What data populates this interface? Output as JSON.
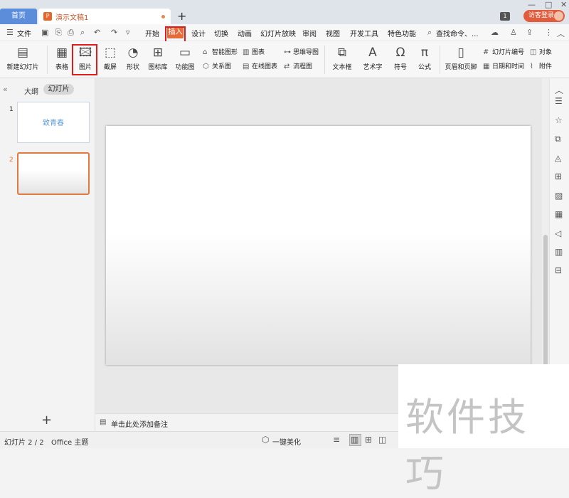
{
  "titlebar": {
    "home_tab": "首页",
    "doc_tab": "演示文稿1",
    "doc_icon": "P",
    "new_tab": "+",
    "window_badge": "1",
    "login": "访客登录",
    "controls": [
      "—",
      "□",
      "✕"
    ]
  },
  "menubar": {
    "file": "文件",
    "tabs": [
      "开始",
      "插入",
      "设计",
      "切换",
      "动画",
      "幻灯片放映",
      "审阅",
      "视图",
      "开发工具",
      "特色功能"
    ],
    "search": "查找命令、...",
    "active_tab": "插入"
  },
  "ribbon": {
    "new_slide": "新建幻灯片",
    "table": "表格",
    "picture": "图片",
    "screenshot": "截屏",
    "shape": "形状",
    "icon_library": "图标库",
    "function_chart": "功能图",
    "smart_art": "智能图形",
    "chart": "图表",
    "mind_map": "思维导图",
    "relation_chart": "关系图",
    "online_chart": "在线图表",
    "flow_chart": "流程图",
    "textbox": "文本框",
    "word_art": "艺术字",
    "symbol": "符号",
    "formula": "公式",
    "header_footer": "页眉和页脚",
    "slide_number": "幻灯片编号",
    "object": "对象",
    "date_time": "日期和时间",
    "attachment": "附件"
  },
  "leftpanel": {
    "outline": "大纲",
    "slides": "幻灯片",
    "slide1_number": "1",
    "slide1_text": "致青春",
    "slide2_number": "2",
    "add": "+"
  },
  "notes": {
    "placeholder": "单击此处添加备注"
  },
  "statusbar": {
    "slide_counter": "幻灯片 2 / 2",
    "theme": "Office 主题",
    "beautify": "一键美化"
  },
  "watermark": "软件技巧",
  "colors": {
    "accent": "#e56b3a",
    "highlight_box": "#e01b1b",
    "home_tab": "#5b8ddb",
    "login": "#e15c3d"
  }
}
